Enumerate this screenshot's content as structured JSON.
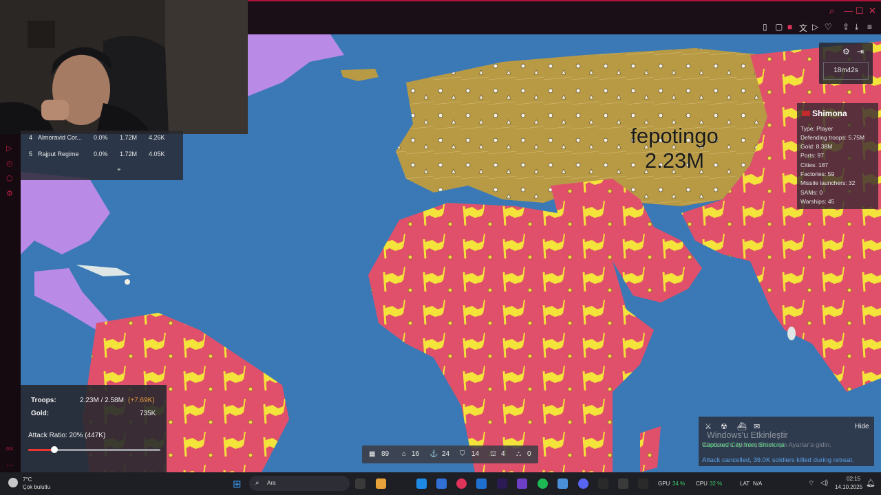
{
  "colors": {
    "ocean": "#3a79b5",
    "fepotingo_territory": "#b89a45",
    "shimona_territory": "#e0506a",
    "shimona_flag": "#f4e33a",
    "purple_territory": "#b98ae6",
    "accent_red": "#e0335a"
  },
  "browser": {
    "window_controls": [
      "search-icon",
      "minimize-icon",
      "maximize-icon",
      "close-icon"
    ],
    "toolbar_icons": [
      "bookmark-icon",
      "square-icon",
      "shield-icon",
      "translate-icon",
      "play-icon",
      "heart-icon",
      "share-icon",
      "download-icon",
      "menu-icon"
    ]
  },
  "leaderboard": {
    "rows": [
      {
        "rank": "4",
        "name": "Almoravid Cor...",
        "pct": "0.0%",
        "troops": "1.72M",
        "gold": "4.26K"
      },
      {
        "rank": "5",
        "name": "Rajput Regime",
        "pct": "0.0%",
        "troops": "1.72M",
        "gold": "4.05K"
      }
    ],
    "expand_label": "+"
  },
  "map": {
    "player_label_name": "fepotingo",
    "player_label_troops": "2.23M"
  },
  "top_panel": {
    "timer": "18m42s",
    "icons": [
      "gear-icon",
      "exit-icon"
    ]
  },
  "player_info": {
    "name": "Shimona",
    "lines": [
      "Type: Player",
      "Defending troops: 5.75M",
      "Gold: 8.38M",
      "Ports: 97",
      "Cities: 187",
      "Factories: 59",
      "Missile launchers: 32",
      "SAMs: 0",
      "Warships: 45"
    ]
  },
  "stats": {
    "troops_label": "Troops:",
    "troops_value": "2.23M / 2.58M",
    "troops_delta": "(+7.69K)",
    "gold_label": "Gold:",
    "gold_value": "735K",
    "attack_ratio_label": "Attack Ratio: 20% (447K)",
    "attack_ratio_fraction": 0.2
  },
  "structures": [
    {
      "icon": "city-icon",
      "count": "89"
    },
    {
      "icon": "factory-icon",
      "count": "16"
    },
    {
      "icon": "port-icon",
      "count": "24"
    },
    {
      "icon": "defense-icon",
      "count": "14"
    },
    {
      "icon": "missile-icon",
      "count": "4"
    },
    {
      "icon": "sam-icon",
      "count": "0"
    }
  ],
  "events": {
    "hide_label": "Hide",
    "captured": "Captured City from Shimona",
    "cancelled": "Attack cancelled, 39.0K soldiers killed during retreat.",
    "filter_icons": [
      "sword-icon",
      "nuke-icon",
      "ship-icon",
      "chat-icon"
    ]
  },
  "windows_watermark": {
    "title": "Windows'u Etkinleştir",
    "subtitle": "Windows'u etkinleştirmek için Ayarlar'a gidin."
  },
  "taskbar": {
    "weather_temp": "7°C",
    "weather_desc": "Çok bulutlu",
    "search_placeholder": "Ara",
    "gpu": "GPU",
    "gpu_val": "34 %",
    "cpu": "CPU",
    "cpu_val": "32 %",
    "lat": "LAT",
    "lat_val": "N/A",
    "time": "02:15",
    "date": "14.10.2025"
  }
}
